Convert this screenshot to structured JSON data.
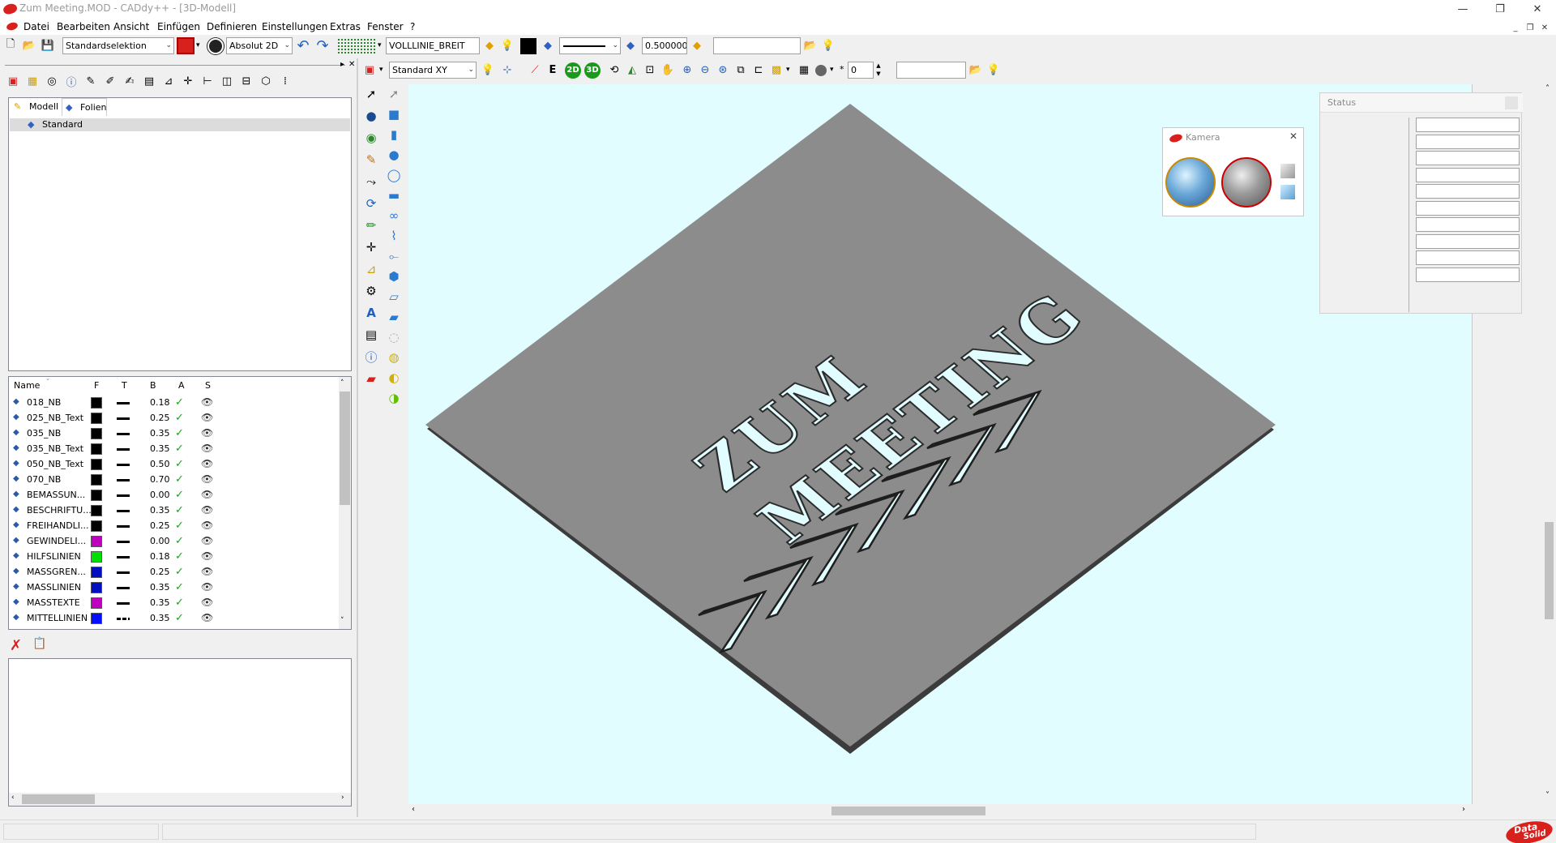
{
  "window": {
    "title": "Zum Meeting.MOD  -  CADdy++ - [3D-Modell]",
    "controls": [
      "—",
      "❐",
      "✕"
    ]
  },
  "menu": [
    "Datei",
    "Bearbeiten",
    "Ansicht",
    "Einfügen",
    "Definieren",
    "Einstellungen",
    "Extras",
    "Fenster",
    "?"
  ],
  "toolbar1": {
    "selection_mode": "Standardselektion",
    "coord_mode": "Absolut 2D",
    "linetype_name": "VOLLLINIE_BREIT",
    "line_width": "0.500000",
    "input_field": ""
  },
  "toolbar2": {
    "view_plane": "Standard XY",
    "btn_2d": "2D",
    "btn_3d": "3D",
    "counter": "0",
    "input_field": ""
  },
  "left_panel": {
    "tabs": [
      "Modell",
      "Folien"
    ],
    "tree_item": "Standard",
    "layer_columns": [
      "Name",
      "F",
      "T",
      "B",
      "A",
      "S"
    ],
    "layers": [
      {
        "name": "018_NB",
        "color": "#000000",
        "width": "0.18"
      },
      {
        "name": "025_NB_Text",
        "color": "#000000",
        "width": "0.25"
      },
      {
        "name": "035_NB",
        "color": "#000000",
        "width": "0.35"
      },
      {
        "name": "035_NB_Text",
        "color": "#000000",
        "width": "0.35"
      },
      {
        "name": "050_NB_Text",
        "color": "#000000",
        "width": "0.50"
      },
      {
        "name": "070_NB",
        "color": "#000000",
        "width": "0.70"
      },
      {
        "name": "BEMASSUN...",
        "color": "#000000",
        "width": "0.00"
      },
      {
        "name": "BESCHRIFTU...",
        "color": "#000000",
        "width": "0.35"
      },
      {
        "name": "FREIHANDLI...",
        "color": "#000000",
        "width": "0.25"
      },
      {
        "name": "GEWINDELI...",
        "color": "#c000c0",
        "width": "0.00"
      },
      {
        "name": "HILFSLINIEN",
        "color": "#00e000",
        "width": "0.18"
      },
      {
        "name": "MASSGREN...",
        "color": "#0010c0",
        "width": "0.25"
      },
      {
        "name": "MASSLINIEN",
        "color": "#0010c0",
        "width": "0.35"
      },
      {
        "name": "MASSTEXTE",
        "color": "#c000c0",
        "width": "0.35"
      },
      {
        "name": "MITTELLINIEN",
        "color": "#0010ff",
        "width": "0.35"
      }
    ]
  },
  "model_text": {
    "line1": "ZUM",
    "line2": "MEETING"
  },
  "camera_window": {
    "title": "Kamera"
  },
  "status_window": {
    "title": "Status"
  },
  "brand": {
    "line1": "Data",
    "line2": "Solid"
  },
  "colors": {
    "viewport_bg": "#e1fdff",
    "plate_top": "#8c8c8c",
    "plate_side": "#4a4a4a",
    "accent_red": "#d8201c"
  }
}
